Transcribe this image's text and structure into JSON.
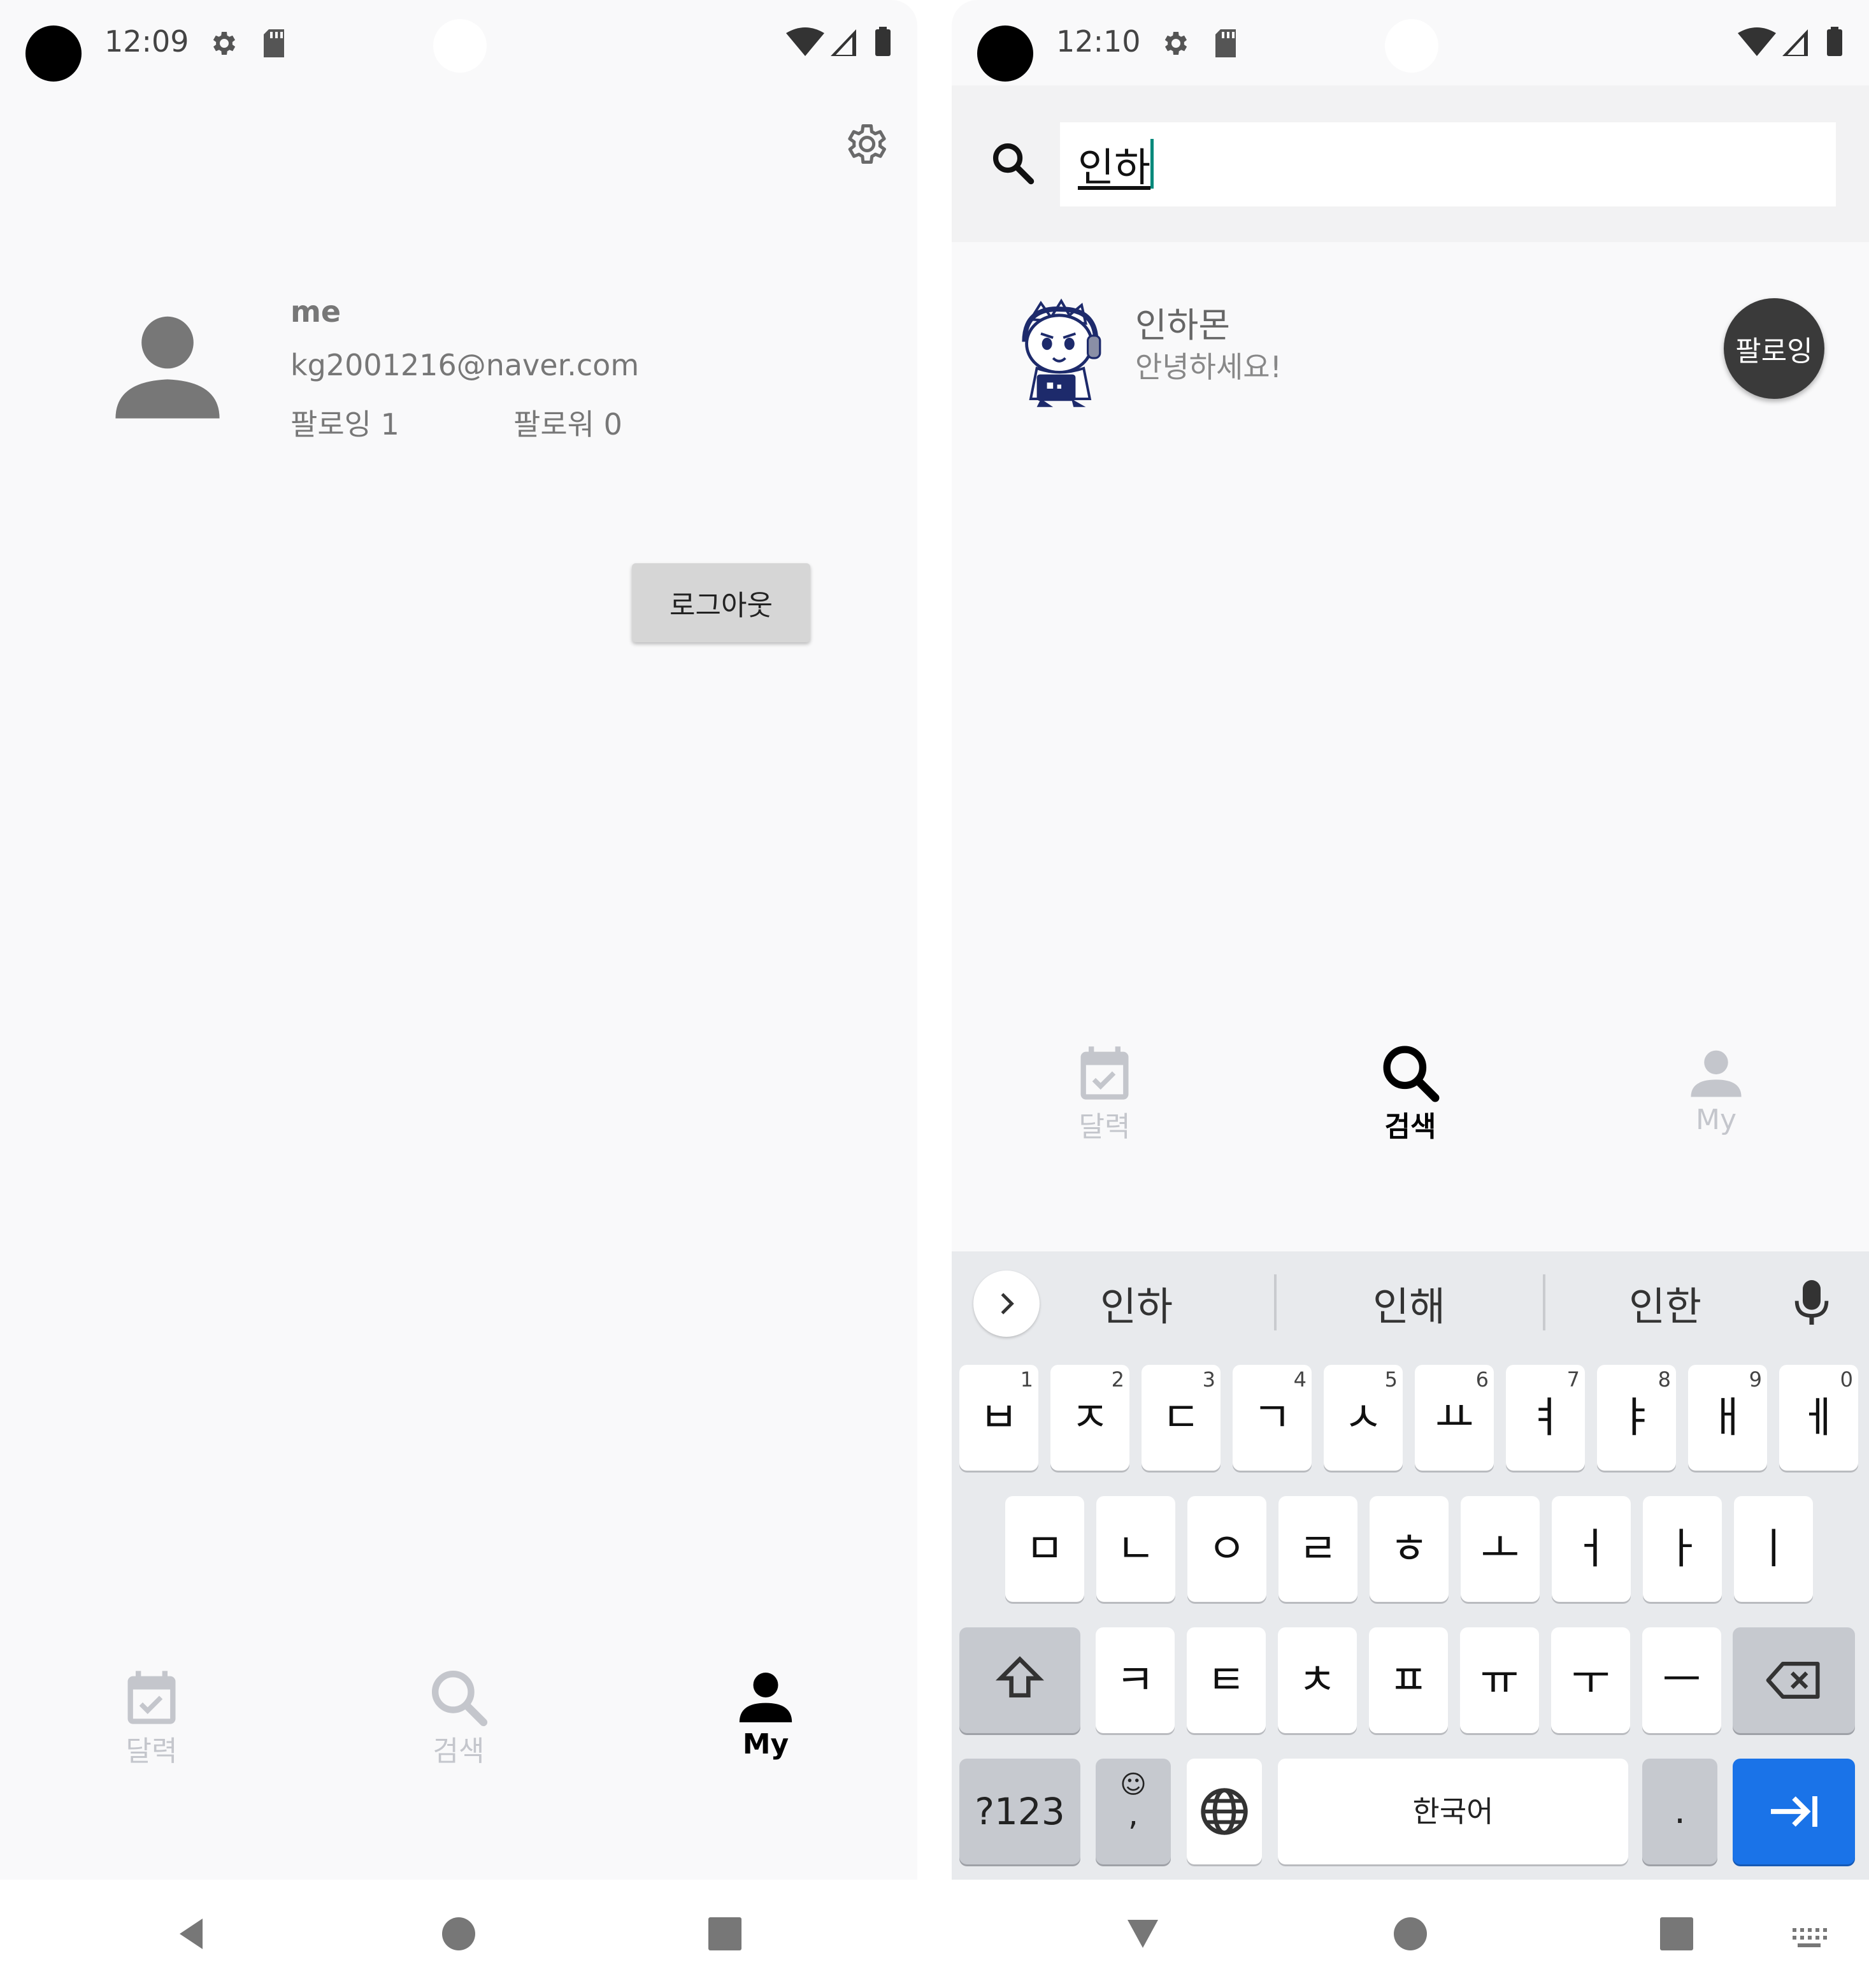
{
  "left_screen": {
    "status_time": "12:09",
    "profile": {
      "name": "me",
      "email": "kg2001216@naver.com",
      "following_label": "팔로잉 1",
      "follower_label": "팔로워 0"
    },
    "logout_label": "로그아웃",
    "tabs": [
      {
        "label": "달력",
        "icon": "calendar-check-icon",
        "active": false
      },
      {
        "label": "검색",
        "icon": "search-icon",
        "active": false
      },
      {
        "label": "My",
        "icon": "person-icon",
        "active": true
      }
    ]
  },
  "right_screen": {
    "status_time": "12:10",
    "search_value": "인하",
    "result": {
      "name": "인하몬",
      "status": "안녕하세요!",
      "follow_label": "팔로잉"
    },
    "tabs": [
      {
        "label": "달력",
        "icon": "calendar-check-icon",
        "active": false
      },
      {
        "label": "검색",
        "icon": "search-icon",
        "active": true
      },
      {
        "label": "My",
        "icon": "person-icon",
        "active": false
      }
    ],
    "keyboard": {
      "suggestions": [
        "인하",
        "인해",
        "인한"
      ],
      "row1": [
        {
          "key": "ㅂ",
          "hint": "1"
        },
        {
          "key": "ㅈ",
          "hint": "2"
        },
        {
          "key": "ㄷ",
          "hint": "3"
        },
        {
          "key": "ㄱ",
          "hint": "4"
        },
        {
          "key": "ㅅ",
          "hint": "5"
        },
        {
          "key": "ㅛ",
          "hint": "6"
        },
        {
          "key": "ㅕ",
          "hint": "7"
        },
        {
          "key": "ㅑ",
          "hint": "8"
        },
        {
          "key": "ㅐ",
          "hint": "9"
        },
        {
          "key": "ㅔ",
          "hint": "0"
        }
      ],
      "row2": [
        "ㅁ",
        "ㄴ",
        "ㅇ",
        "ㄹ",
        "ㅎ",
        "ㅗ",
        "ㅓ",
        "ㅏ",
        "ㅣ"
      ],
      "row3": [
        "ㅋ",
        "ㅌ",
        "ㅊ",
        "ㅍ",
        "ㅠ",
        "ㅜ",
        "ㅡ"
      ],
      "symbols_label": "?123",
      "emoji_top": "☺",
      "emoji_bottom": ",",
      "space_label": "한국어",
      "period_label": "."
    }
  },
  "colors": {
    "accent_blue": "#1a73e8",
    "follow_button": "#3a3a3a",
    "cursor": "#00897b",
    "inactive_tab": "#c4c6cc",
    "profile_icon": "#777777"
  }
}
